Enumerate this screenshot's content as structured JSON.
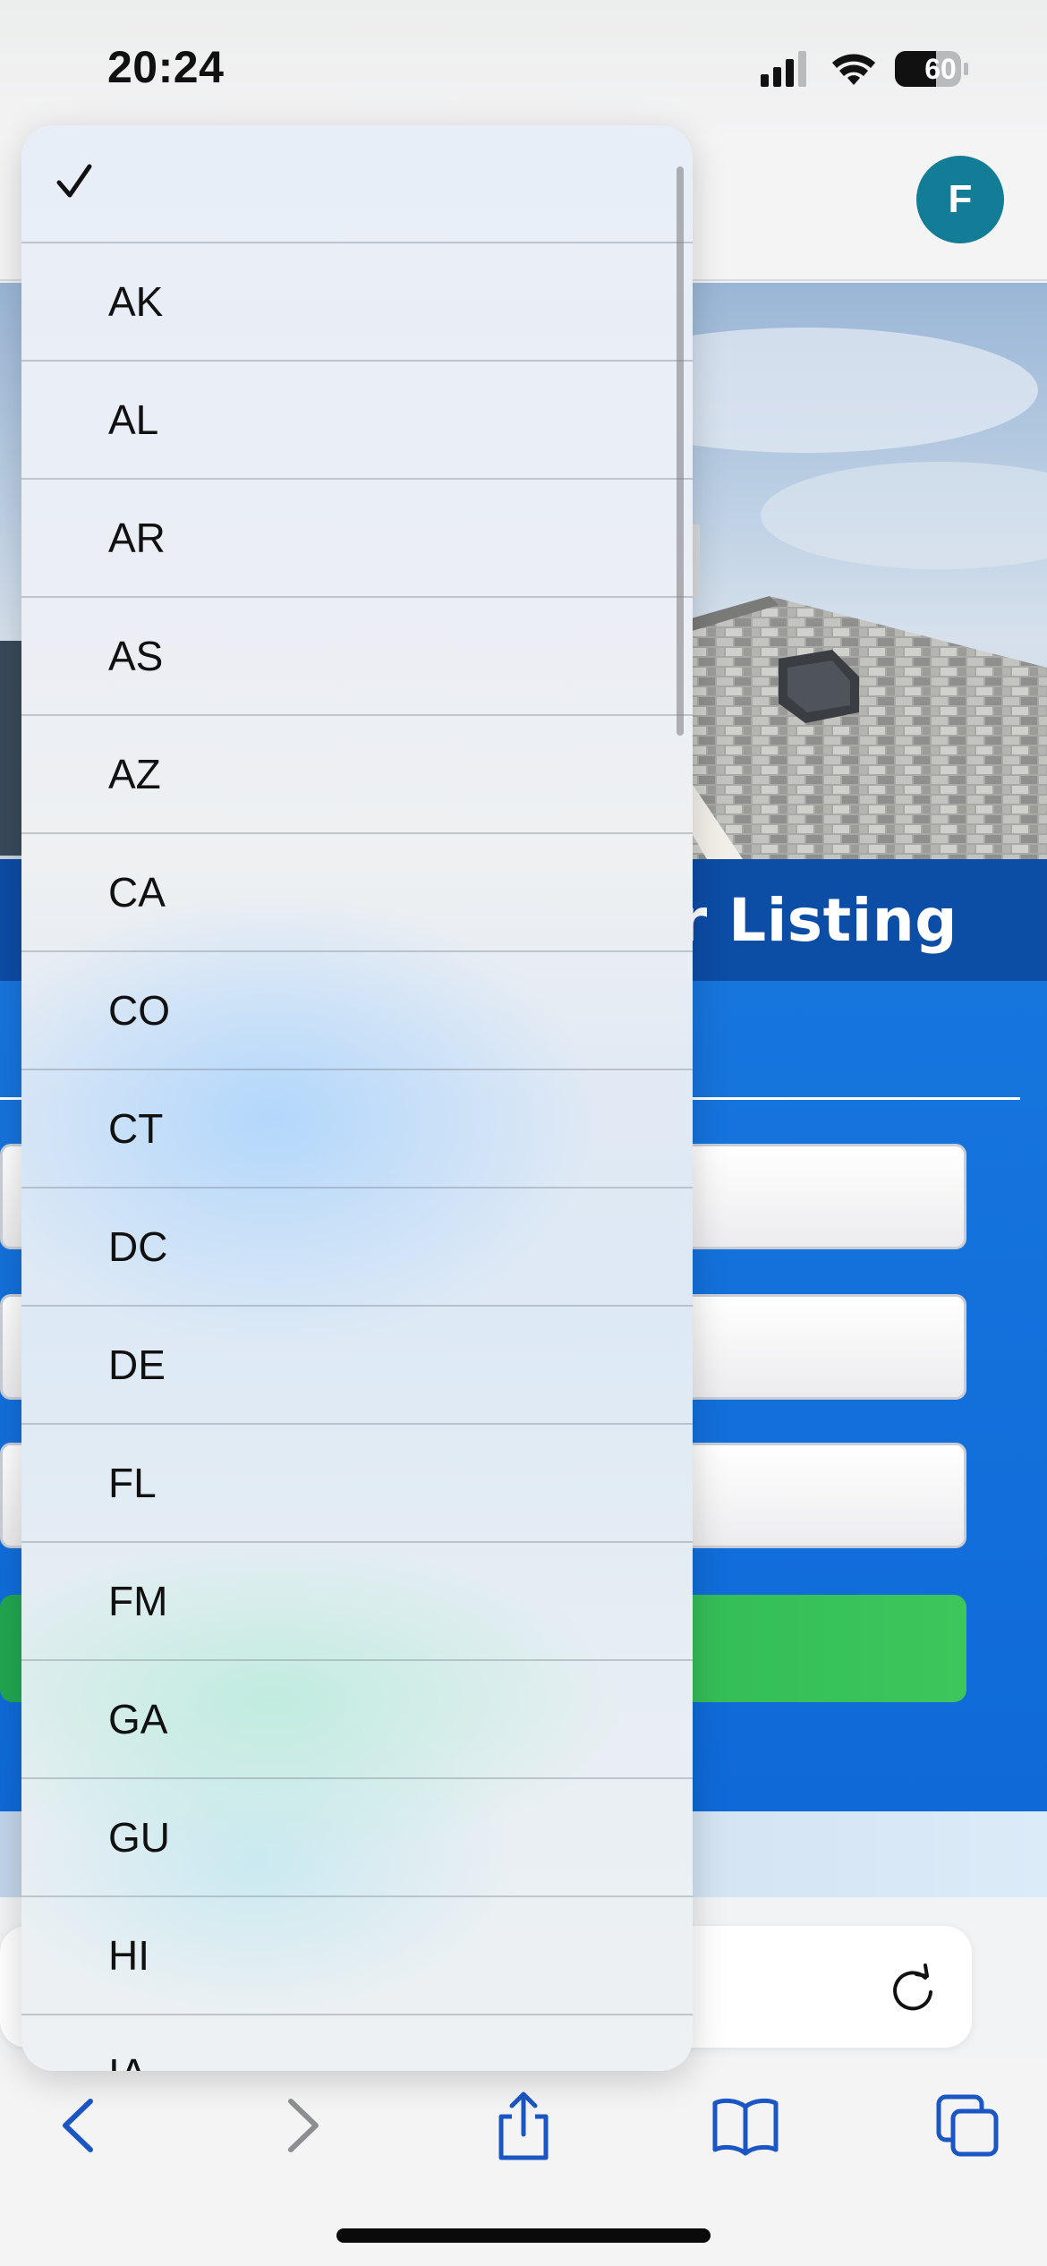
{
  "status_bar": {
    "time": "20:24",
    "battery": "60",
    "icons": [
      "cellular-signal-icon",
      "wifi-icon",
      "battery-icon"
    ]
  },
  "header": {
    "avatar_initial": "F",
    "avatar_color": "#137c96"
  },
  "page": {
    "title_partial": "er Listing",
    "accent_blue": "#0c4da5",
    "button_green": "#2fb657"
  },
  "picker": {
    "selected_index": 0,
    "items": [
      {
        "label": ""
      },
      {
        "label": "AK"
      },
      {
        "label": "AL"
      },
      {
        "label": "AR"
      },
      {
        "label": "AS"
      },
      {
        "label": "AZ"
      },
      {
        "label": "CA"
      },
      {
        "label": "CO"
      },
      {
        "label": "CT"
      },
      {
        "label": "DC"
      },
      {
        "label": "DE"
      },
      {
        "label": "FL"
      },
      {
        "label": "FM"
      },
      {
        "label": "GA"
      },
      {
        "label": "GU"
      },
      {
        "label": "HI"
      },
      {
        "label": "IA"
      }
    ]
  },
  "toolbar": {
    "icons": [
      "back-icon",
      "forward-icon",
      "share-icon",
      "bookmarks-icon",
      "tabs-icon"
    ],
    "accent": "#1a56c4"
  }
}
